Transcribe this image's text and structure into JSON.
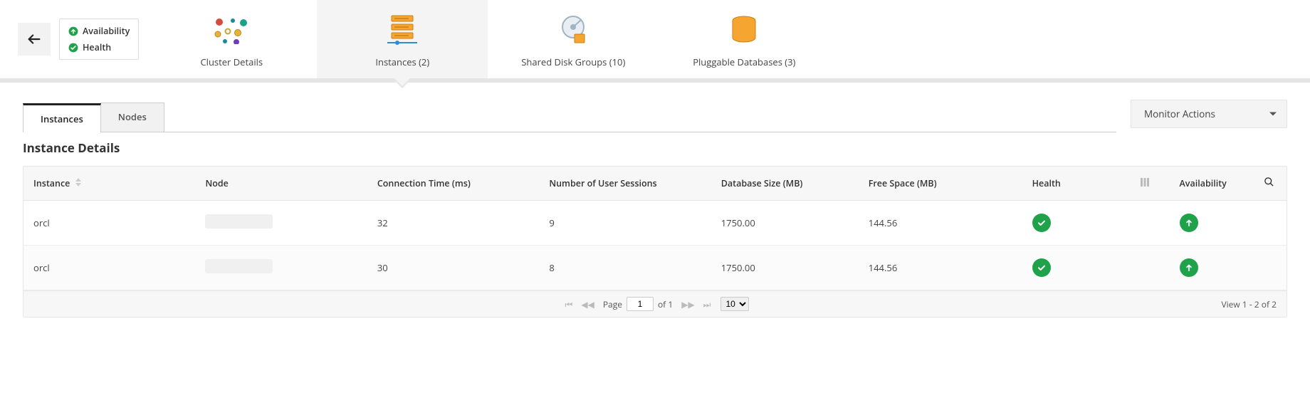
{
  "status_box": {
    "availability_label": "Availability",
    "health_label": "Health"
  },
  "nav": {
    "cluster_details": "Cluster Details",
    "instances": "Instances (2)",
    "shared_disk_groups": "Shared Disk Groups (10)",
    "pluggable_databases": "Pluggable Databases (3)"
  },
  "tabs": {
    "instances": "Instances",
    "nodes": "Nodes"
  },
  "monitor_actions_label": "Monitor Actions",
  "section_title": "Instance Details",
  "columns": {
    "instance": "Instance",
    "node": "Node",
    "connection_time": "Connection Time (ms)",
    "user_sessions": "Number of User Sessions",
    "db_size": "Database Size (MB)",
    "free_space": "Free Space (MB)",
    "health": "Health",
    "availability": "Availability"
  },
  "rows": [
    {
      "instance": "orcl",
      "node": "",
      "connection_time": "32",
      "user_sessions": "9",
      "db_size": "1750.00",
      "free_space": "144.56",
      "health": "ok",
      "availability": "up"
    },
    {
      "instance": "orcl",
      "node": "",
      "connection_time": "30",
      "user_sessions": "8",
      "db_size": "1750.00",
      "free_space": "144.56",
      "health": "ok",
      "availability": "up"
    }
  ],
  "pager": {
    "page_label": "Page",
    "page": "1",
    "of_label": "of 1",
    "page_size": "10",
    "summary": "View 1 - 2 of 2"
  }
}
